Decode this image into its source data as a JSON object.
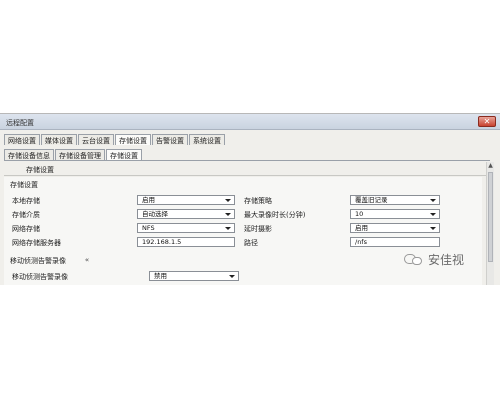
{
  "window": {
    "title": "远程配置",
    "close_label": "✕"
  },
  "tabs_main": [
    "网络设置",
    "媒体设置",
    "云台设置",
    "存储设置",
    "告警设置",
    "系统设置"
  ],
  "tabs_main_active": 3,
  "tabs_sub": [
    "存储设备信息",
    "存储设备管理",
    "存储设置"
  ],
  "tabs_sub_active": 2,
  "panel_heading": "存储设置",
  "group_title": "存储设置",
  "left_fields": [
    {
      "label": "本地存储",
      "value": "启用",
      "type": "select"
    },
    {
      "label": "存储介质",
      "value": "自动选择",
      "type": "select"
    },
    {
      "label": "网络存储",
      "value": "NFS",
      "type": "select"
    },
    {
      "label": "网络存储服务器",
      "value": "192.168.1.5",
      "type": "text"
    }
  ],
  "right_fields": [
    {
      "label": "存储策略",
      "value": "覆盖旧记录",
      "type": "select"
    },
    {
      "label": "最大录像时长(分钟)",
      "value": "10",
      "type": "select"
    },
    {
      "label": "延时摄影",
      "value": "启用",
      "type": "select"
    },
    {
      "label": "路径",
      "value": "/nfs",
      "type": "text"
    }
  ],
  "section2": {
    "title": "移动侦测告警录像",
    "collapse_icon": "«",
    "field": {
      "label": "移动侦测告警录像",
      "value": "禁用",
      "type": "select"
    }
  },
  "scroll_up_icon": "▲",
  "watermark": {
    "text": "安佳视"
  }
}
